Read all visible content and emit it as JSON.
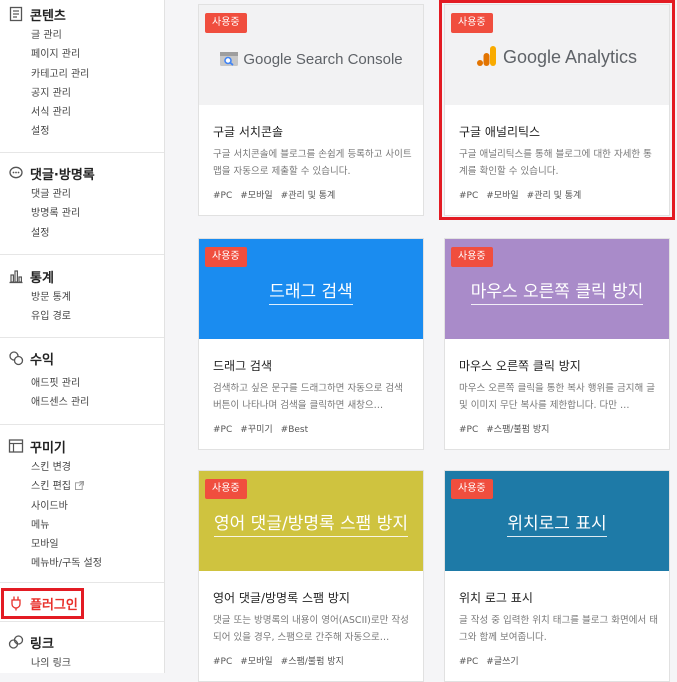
{
  "sidebar": {
    "sections": [
      {
        "icon": "document-icon",
        "title": "콘텐츠",
        "items": [
          "글 관리",
          "페이지 관리",
          "카테고리 관리",
          "공지 관리",
          "서식 관리",
          "설정"
        ]
      },
      {
        "icon": "speech-bubble-icon",
        "title": "댓글·방명록",
        "items": [
          "댓글 관리",
          "방명록 관리",
          "설정"
        ]
      },
      {
        "icon": "bar-chart-icon",
        "title": "통계",
        "items": [
          "방문 통계",
          "유입 경로"
        ]
      },
      {
        "icon": "coins-icon",
        "title": "수익",
        "items": [
          "애드핏 관리",
          "애드센스 관리"
        ]
      },
      {
        "icon": "layout-icon",
        "title": "꾸미기",
        "items": [
          "스킨 변경",
          "스킨 편집",
          "사이드바",
          "메뉴",
          "모바일",
          "메뉴바/구독 설정"
        ]
      },
      {
        "icon": "plug-icon",
        "title": "플러그인",
        "items": []
      },
      {
        "icon": "link-icon",
        "title": "링크",
        "items": [
          "나의 링크"
        ]
      }
    ]
  },
  "cards": [
    {
      "badge": "사용중",
      "logo": "Google Search Console",
      "title": "구글 서치콘솔",
      "desc": "구글 서치콘솔에 블로그를 손쉽게 등록하고 사이트맵을 자동으로 제출할 수 있습니다.",
      "tags": [
        "#PC",
        "#모바일",
        "#관리 및 통계"
      ]
    },
    {
      "badge": "사용중",
      "logo": "Google Analytics",
      "title": "구글 애널리틱스",
      "desc": "구글 애널리틱스를 통해 블로그에 대한 자세한 통계를 확인할 수 있습니다.",
      "tags": [
        "#PC",
        "#모바일",
        "#관리 및 통계"
      ]
    },
    {
      "badge": "사용중",
      "thumb_label": "드래그 검색",
      "thumb_color": "#1a8cf0",
      "title": "드래그 검색",
      "desc": "검색하고 싶은 문구를 드래그하면 자동으로 검색 버튼이 나타나며 검색을 클릭하면 새창으…",
      "tags": [
        "#PC",
        "#꾸미기",
        "#Best"
      ]
    },
    {
      "badge": "사용중",
      "thumb_label": "마우스 오른쪽 클릭 방지",
      "thumb_color": "#a98bc9",
      "title": "마우스 오른쪽 클릭 방지",
      "desc": "마우스 오른쪽 클릭을 통한 복사 행위를 금지해 글 및 이미지 무단 복사를 제한합니다. 다만 …",
      "tags": [
        "#PC",
        "#스팸/불펌 방지"
      ]
    },
    {
      "badge": "사용중",
      "thumb_label": "영어 댓글/방명록 스팸 방지",
      "thumb_color": "#cfc33f",
      "title": "영어 댓글/방명록 스팸 방지",
      "desc": "댓글 또는 방명록의 내용이 영어(ASCII)로만 작성되어 있을 경우, 스팸으로 간주해 자동으로…",
      "tags": [
        "#PC",
        "#모바일",
        "#스팸/불펌 방지"
      ]
    },
    {
      "badge": "사용중",
      "thumb_label": "위치로그 표시",
      "thumb_color": "#1e7aa7",
      "title": "위치 로그 표시",
      "desc": "글 작성 중 입력한 위치 태그를 블로그 화면에서 태그와 함께 보여줍니다.",
      "tags": [
        "#PC",
        "#글쓰기"
      ]
    }
  ],
  "colors": {
    "badge": "#f04e3e",
    "highlight": "#e31b23",
    "plugin_active": "#e8302a"
  }
}
